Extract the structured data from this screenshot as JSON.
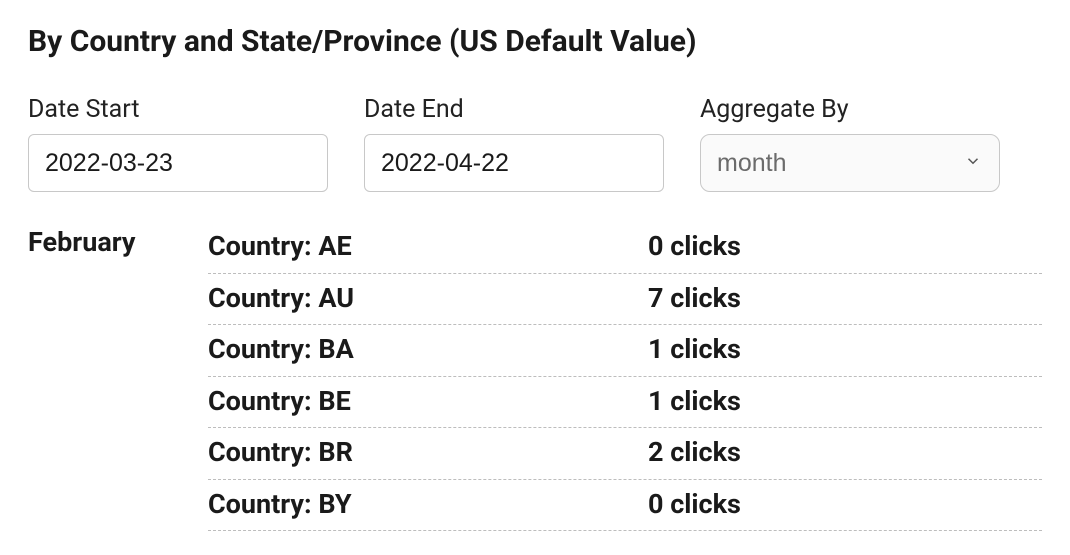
{
  "header": {
    "title": "By Country and State/Province (US Default Value)"
  },
  "filters": {
    "date_start": {
      "label": "Date Start",
      "value": "2022-03-23"
    },
    "date_end": {
      "label": "Date End",
      "value": "2022-04-22"
    },
    "aggregate": {
      "label": "Aggregate By",
      "value": "month"
    }
  },
  "results": {
    "month_label": "February",
    "country_prefix": "Country: ",
    "clicks_suffix": " clicks",
    "rows": [
      {
        "country": "AE",
        "clicks": 0
      },
      {
        "country": "AU",
        "clicks": 7
      },
      {
        "country": "BA",
        "clicks": 1
      },
      {
        "country": "BE",
        "clicks": 1
      },
      {
        "country": "BR",
        "clicks": 2
      },
      {
        "country": "BY",
        "clicks": 0
      }
    ]
  }
}
